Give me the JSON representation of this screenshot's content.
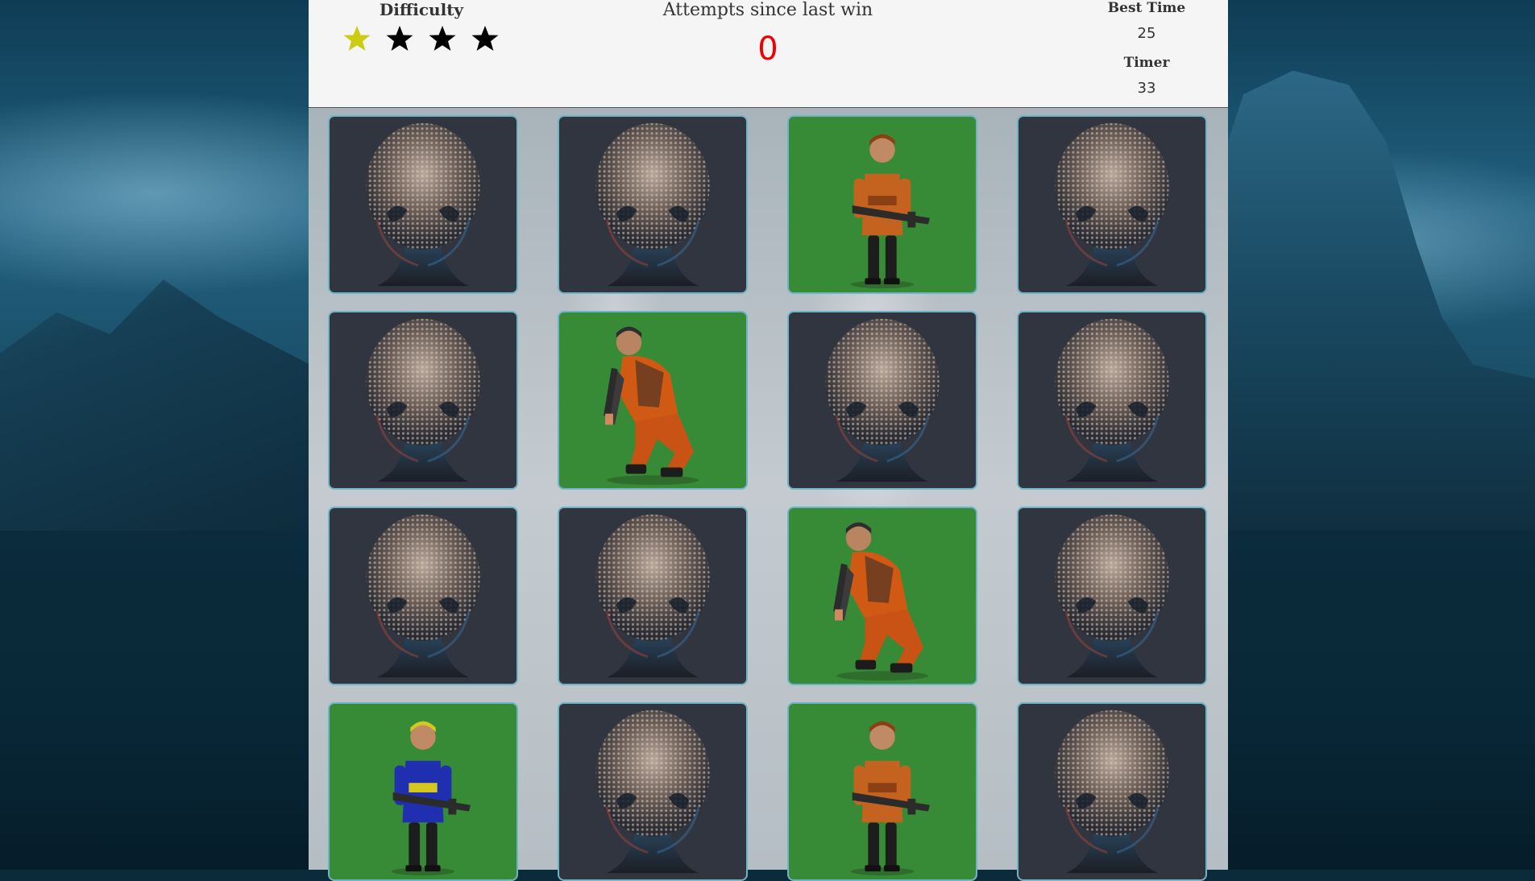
{
  "header": {
    "difficulty_label": "Difficulty",
    "difficulty_level": 1,
    "difficulty_max": 4,
    "attempts_label": "Attempts since last win",
    "attempts_value": "0",
    "best_time_label": "Best Time",
    "best_time_value": "25",
    "timer_label": "Timer",
    "timer_value": "33"
  },
  "colors": {
    "star_active": "#cccc10",
    "star_inactive": "#000000",
    "attempts_value": "#f20000",
    "card_back": "#303540",
    "card_front": "#378a36"
  },
  "board": {
    "columns": 4,
    "cards": [
      {
        "state": "face-down",
        "icon": "alien-head-icon"
      },
      {
        "state": "face-down",
        "icon": "alien-head-icon"
      },
      {
        "state": "face-up",
        "icon": "soldier-standing-orange-icon"
      },
      {
        "state": "face-down",
        "icon": "alien-head-icon"
      },
      {
        "state": "face-down",
        "icon": "alien-head-icon"
      },
      {
        "state": "face-up",
        "icon": "soldier-crouching-orange-icon"
      },
      {
        "state": "face-down",
        "icon": "alien-head-icon"
      },
      {
        "state": "face-down",
        "icon": "alien-head-icon"
      },
      {
        "state": "face-down",
        "icon": "alien-head-icon"
      },
      {
        "state": "face-down",
        "icon": "alien-head-icon"
      },
      {
        "state": "face-up",
        "icon": "soldier-crouching-orange-icon"
      },
      {
        "state": "face-down",
        "icon": "alien-head-icon"
      },
      {
        "state": "face-up",
        "icon": "soldier-standing-blue-icon"
      },
      {
        "state": "face-down",
        "icon": "alien-head-icon"
      },
      {
        "state": "face-up",
        "icon": "soldier-standing-orange-icon"
      },
      {
        "state": "face-down",
        "icon": "alien-head-icon"
      }
    ]
  }
}
